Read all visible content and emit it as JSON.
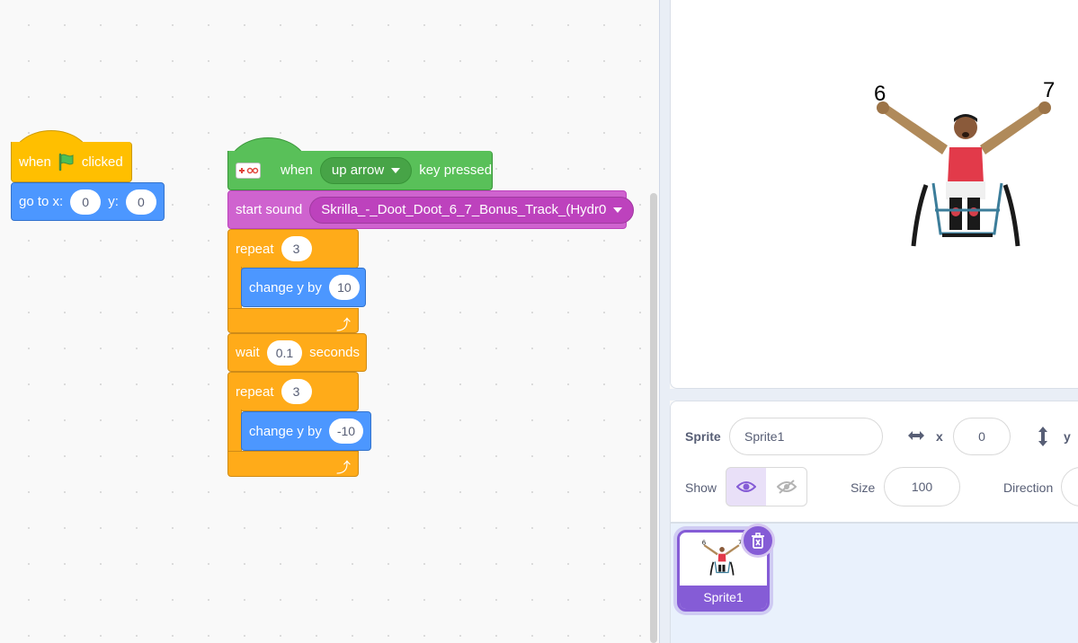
{
  "workspace": {
    "script1": {
      "when_label": "when",
      "clicked_label": "clicked",
      "goto_label": "go to x:",
      "goto_x": "0",
      "y_label": "y:",
      "goto_y": "0"
    },
    "script2": {
      "when_label": "when",
      "key_value": "up arrow",
      "key_pressed_label": "key pressed",
      "start_sound_label": "start sound",
      "sound_value": "Skrilla_-_Doot_Doot_6_7_Bonus_Track_(Hydr0",
      "repeat_label": "repeat",
      "repeat1_count": "3",
      "change_y_label": "change y by",
      "change1_value": "10",
      "wait_label": "wait",
      "wait_value": "0.1",
      "seconds_label": "seconds",
      "repeat2_count": "3",
      "change2_value": "-10"
    }
  },
  "stage": {
    "label_left": "6",
    "label_right": "7"
  },
  "sprite_info": {
    "sprite_label": "Sprite",
    "sprite_name": "Sprite1",
    "x_label": "x",
    "x_value": "0",
    "y_label": "y",
    "show_label": "Show",
    "size_label": "Size",
    "size_value": "100",
    "direction_label": "Direction"
  },
  "sprite_pane": {
    "sprites": [
      {
        "name": "Sprite1",
        "label_left": "6",
        "label_right": "7"
      }
    ]
  },
  "colors": {
    "events": "#ffbf00",
    "extension": "#59c059",
    "motion": "#4c97ff",
    "sound": "#cf63cf",
    "control": "#ffab19",
    "selected": "#855cd6"
  },
  "icons": [
    "green-flag-icon",
    "makey-extension-icon",
    "dropdown-caret-icon",
    "loop-arrow-icon",
    "eye-icon",
    "eye-slash-icon",
    "horizontal-arrows-icon",
    "vertical-arrows-icon",
    "trash-icon"
  ]
}
